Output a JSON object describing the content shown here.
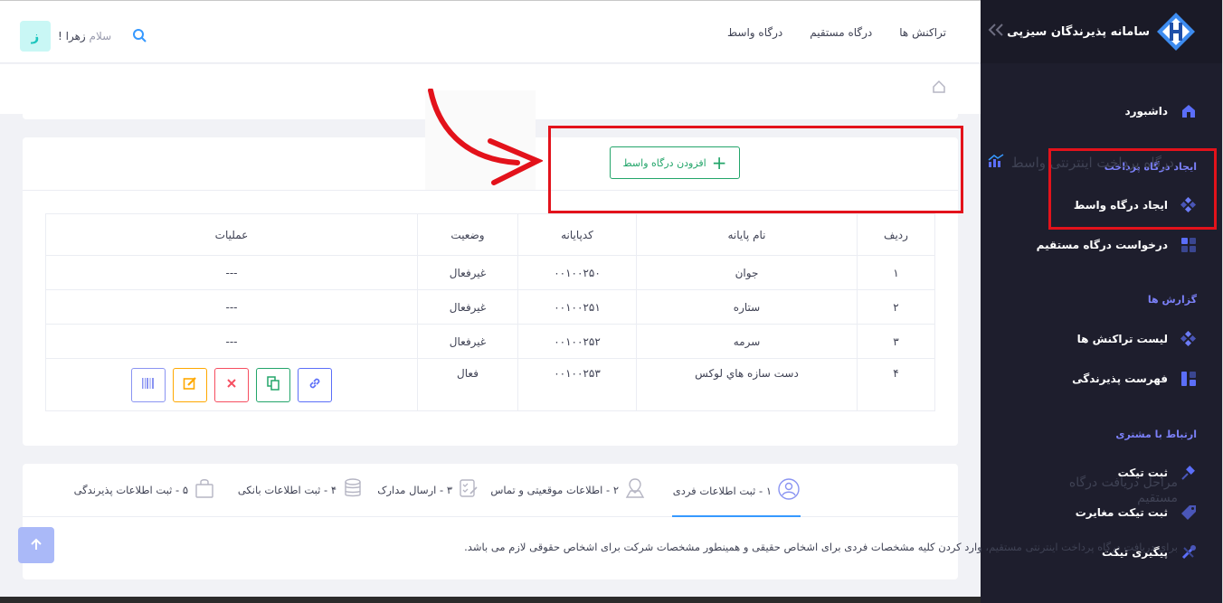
{
  "sidebar": {
    "brand": "سامانه پذیرندگان سیزپی",
    "collapse_icon": "double-chevron-icon",
    "items": [
      {
        "label": "داشبورد",
        "icon": "home-icon"
      },
      {
        "label": "ایجاد درگاه واسط",
        "icon": "diamond-grid-icon"
      },
      {
        "label": "درخواست درگاه مستقیم",
        "icon": "grid-icon"
      },
      {
        "label": "لیست تراکنش ها",
        "icon": "diamond-grid-icon"
      },
      {
        "label": "فهرست پذیرندگی",
        "icon": "list-icon"
      },
      {
        "label": "ثبت تیکت",
        "icon": "pin-icon"
      },
      {
        "label": "ثبت تیکت مغایرت",
        "icon": "tag-icon"
      },
      {
        "label": "پیگیری تیکت",
        "icon": "tools-icon"
      }
    ],
    "sections": [
      "ایجاد درگاه پرداخت",
      "گزارش ها",
      "ارتباط با مشتری"
    ]
  },
  "topbar": {
    "nav": [
      "تراکنش ها",
      "درگاه مستقیم",
      "درگاه واسط"
    ],
    "greeting_prefix": "سلام",
    "user_name": "زهرا !",
    "avatar_letter": "ز"
  },
  "card": {
    "title": "درگاه پرداخت اینترنتی واسط",
    "add_button": "افزودن درگاه واسط"
  },
  "table": {
    "headers": [
      "ردیف",
      "نام پایانه",
      "کدپایانه",
      "وضعیت",
      "عملیات"
    ],
    "rows": [
      [
        "۱",
        "جوان",
        "۰۰۱۰۰۲۵۰",
        "غیرفعال",
        "---"
      ],
      [
        "۲",
        "ستاره",
        "۰۰۱۰۰۲۵۱",
        "غیرفعال",
        "---"
      ],
      [
        "۳",
        "سرمه",
        "۰۰۱۰۰۲۵۲",
        "غیرفعال",
        "---"
      ],
      [
        "۴",
        "دست سازه هاي لوکس",
        "۰۰۱۰۰۲۵۳",
        "فعال",
        ""
      ]
    ]
  },
  "steps": {
    "title": "مراحل دریافت درگاه مستقیم",
    "items": [
      "۱ - ثبت اطلاعات فردی",
      "۲ - اطلاعات موقعیتی و تماس",
      "۳ - ارسال مدارک",
      "۴ - ثبت اطلاعات بانکی",
      "۵ - ثبت اطلاعات پذیرندگی"
    ],
    "description": "برای دریافت درگاه پرداخت اینترنتی مستقیم، وارد کردن کلیه مشخصات فردی برای اشخاص حقیقی و همینطور مشخصات شرکت برای اشخاص حقوقی لازم می باشد."
  },
  "colors": {
    "sidebar_bg": "#1e1e2d",
    "accent": "#3699ff",
    "success": "#23a56a",
    "danger": "#f64e60",
    "warning": "#ffa800",
    "highlight": "#e3121b"
  }
}
